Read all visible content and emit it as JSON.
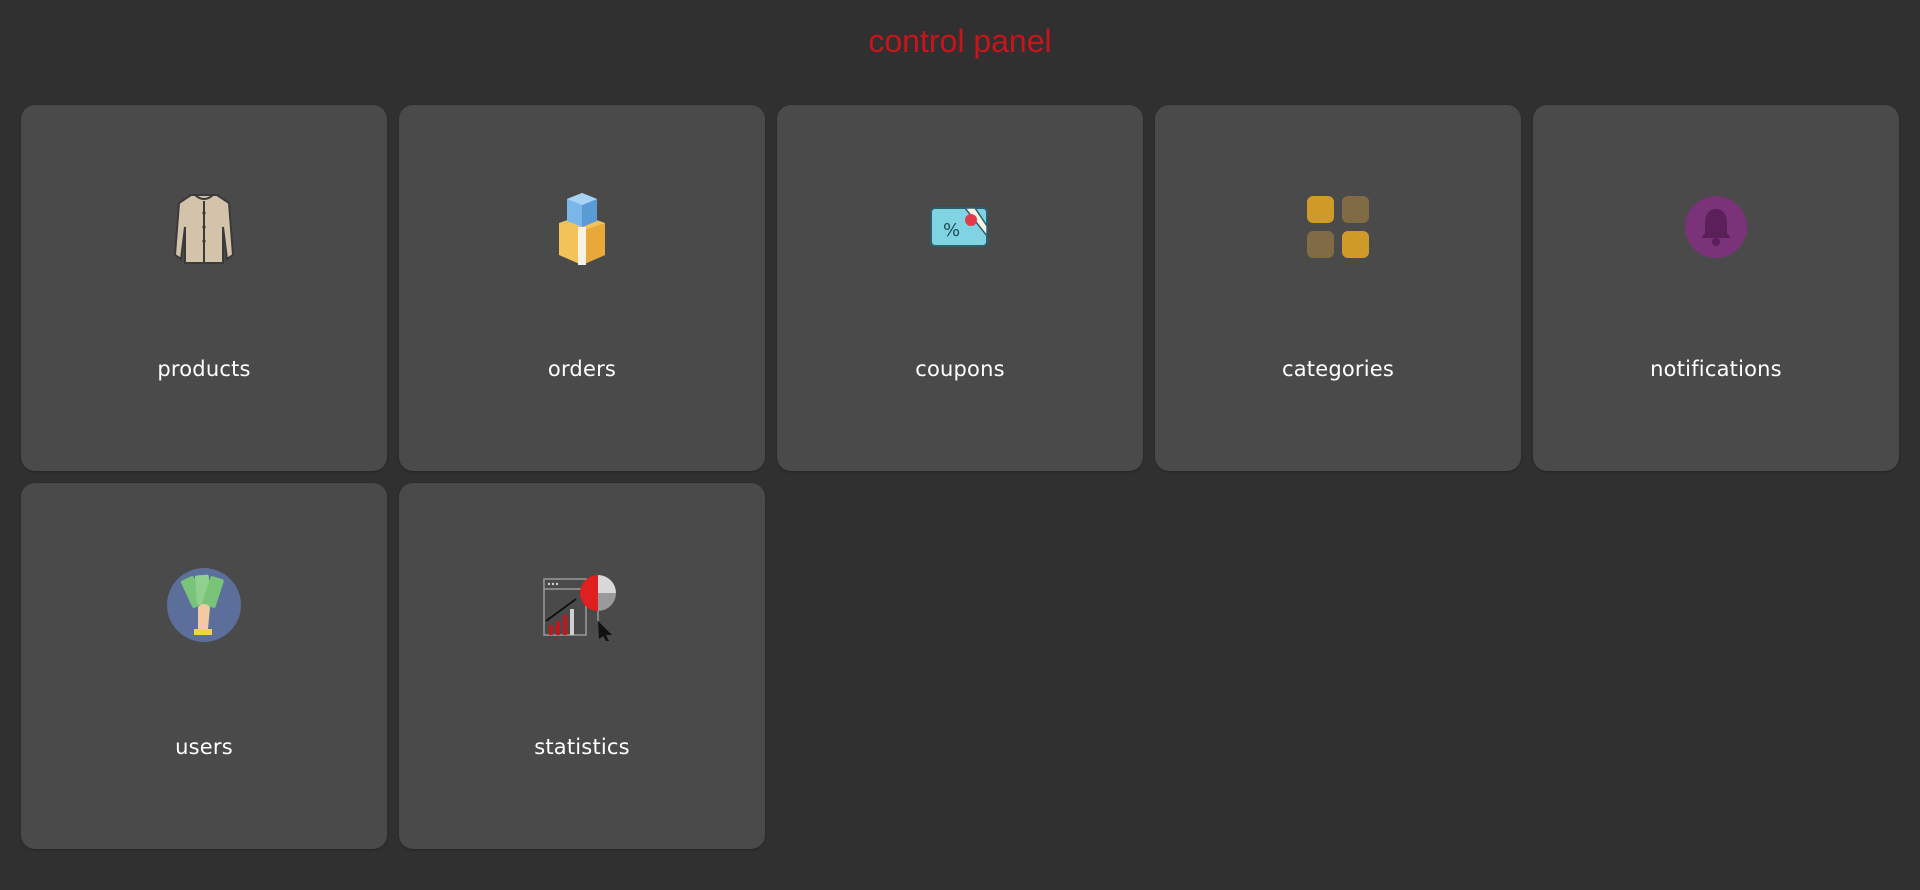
{
  "header": {
    "title": "control panel"
  },
  "colors": {
    "background": "#303030",
    "card": "#4a4a4a",
    "title": "#c8141b",
    "label": "#ffffff"
  },
  "cards": [
    {
      "label": "products",
      "icon": "shirt-icon"
    },
    {
      "label": "orders",
      "icon": "package-icon"
    },
    {
      "label": "coupons",
      "icon": "coupon-icon"
    },
    {
      "label": "categories",
      "icon": "grid-icon"
    },
    {
      "label": "notifications",
      "icon": "bell-icon"
    },
    {
      "label": "users",
      "icon": "money-hand-icon"
    },
    {
      "label": "statistics",
      "icon": "chart-icon"
    }
  ]
}
